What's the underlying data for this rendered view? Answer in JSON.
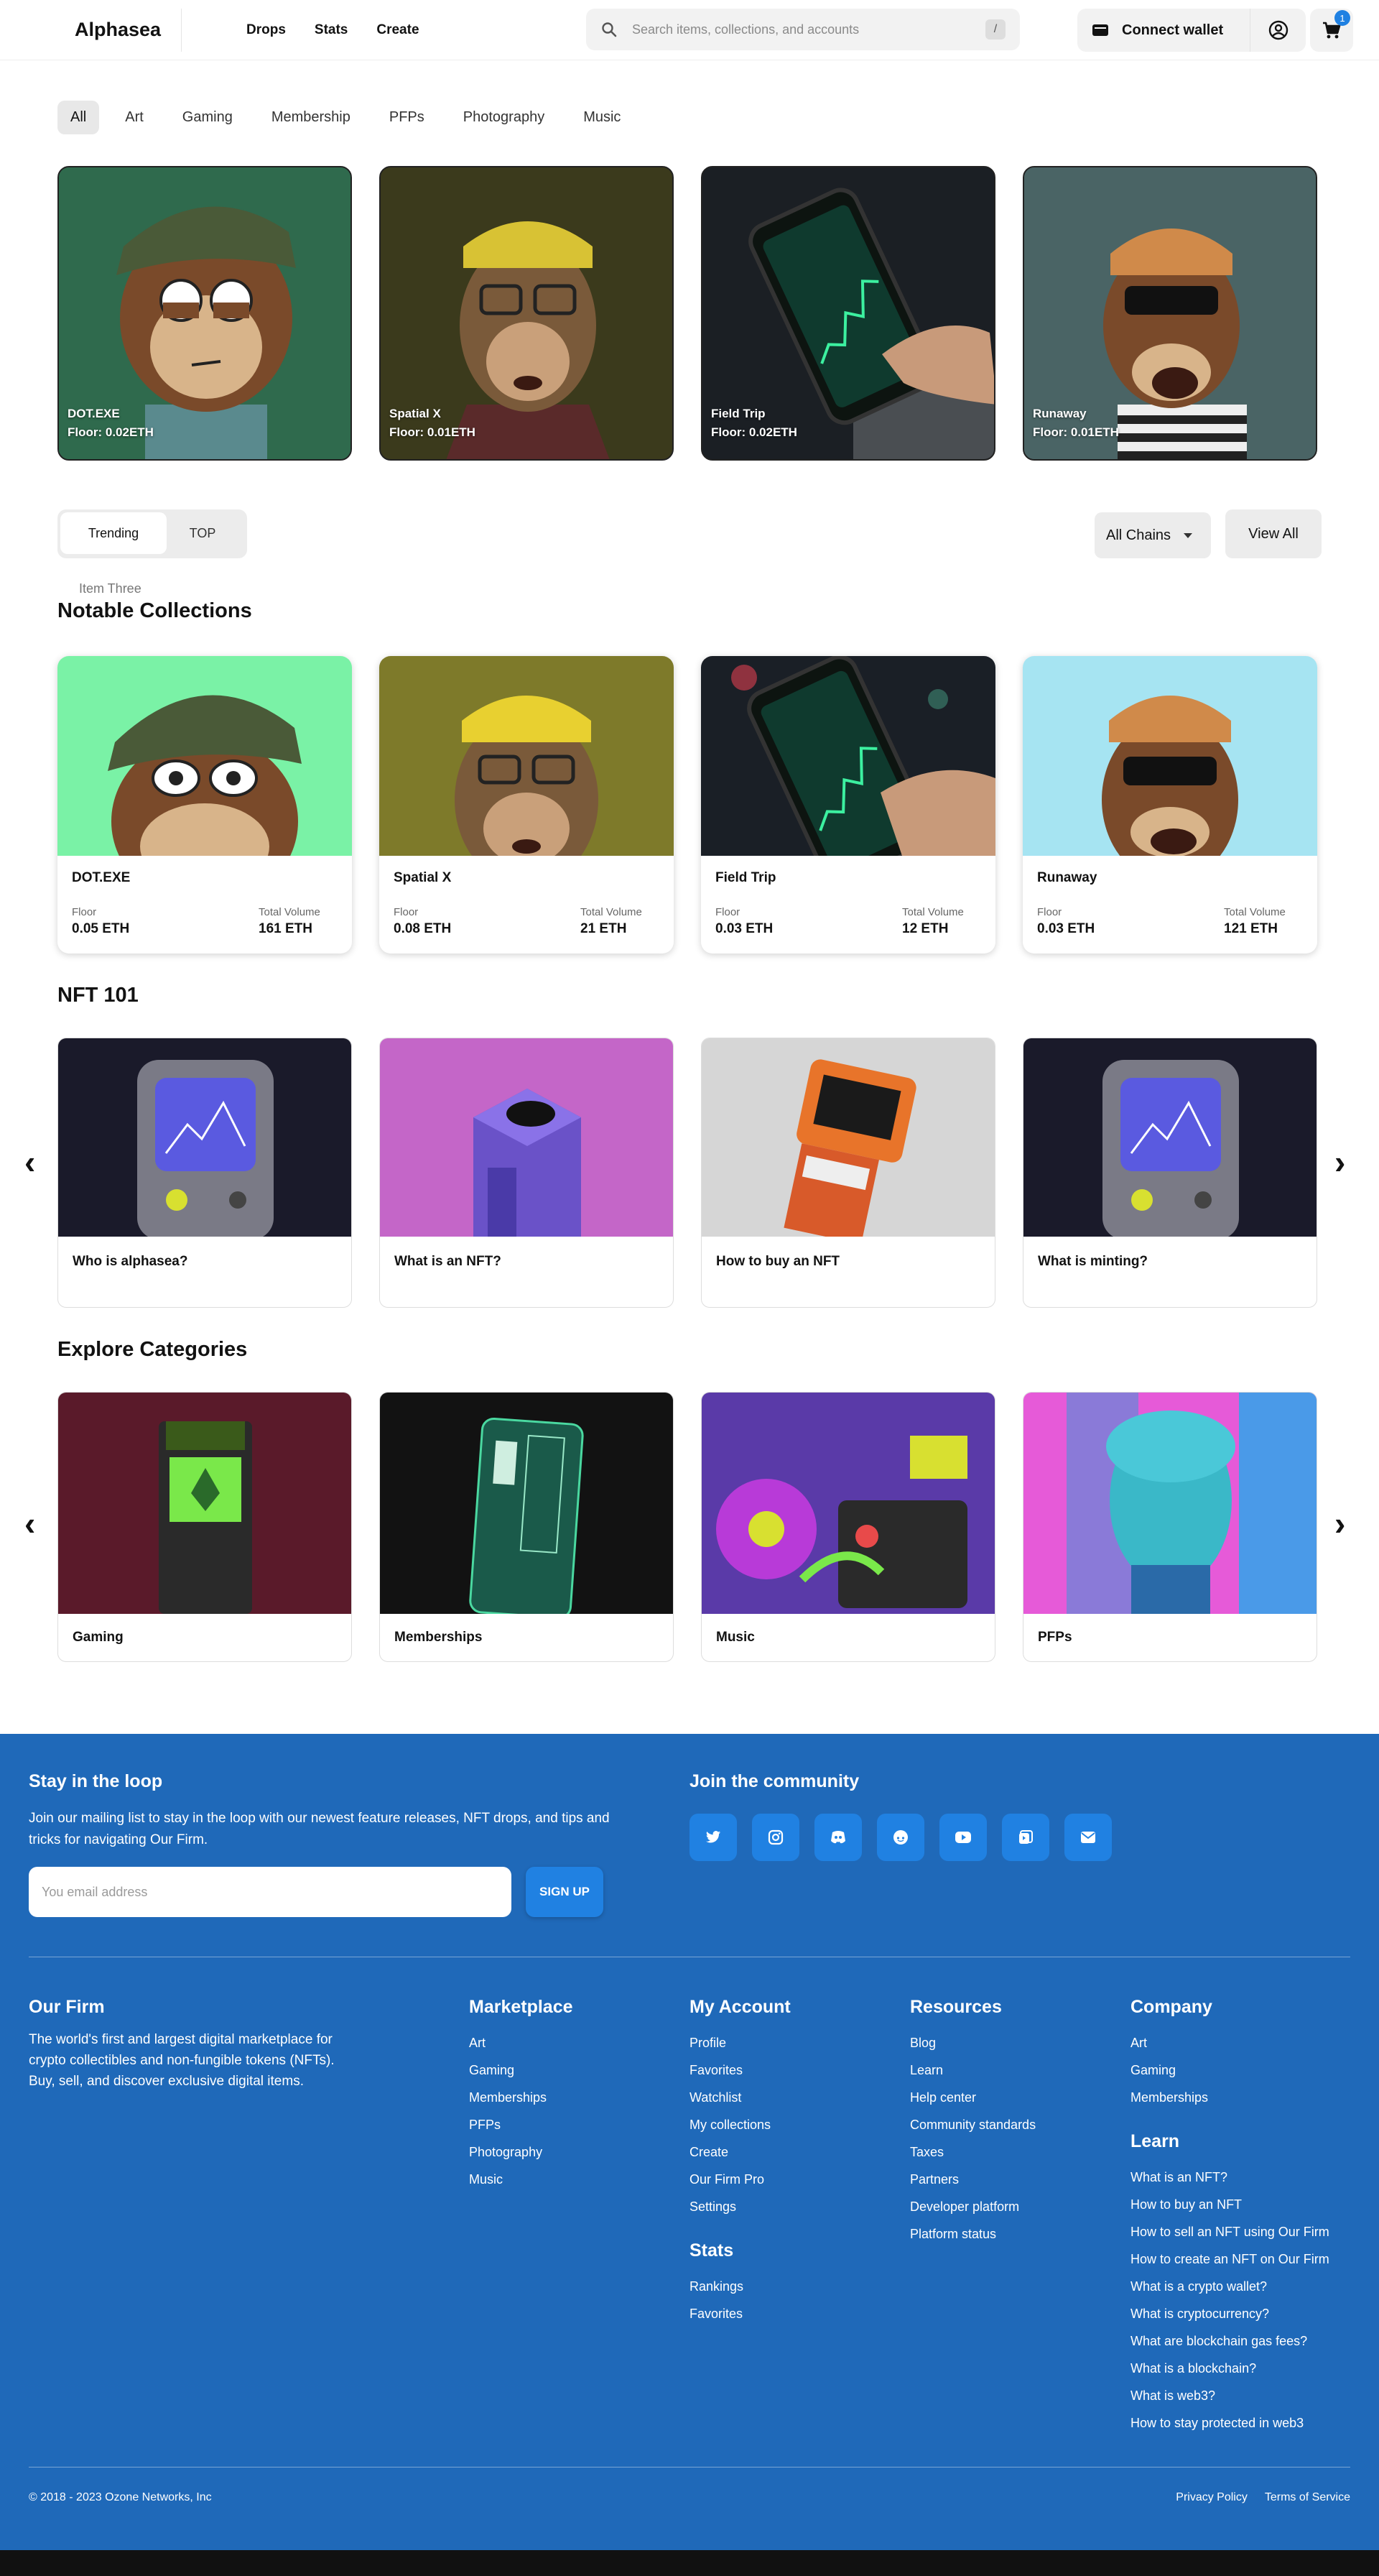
{
  "header": {
    "logo": "Alphasea",
    "nav": [
      "Drops",
      "Stats",
      "Create"
    ],
    "search_placeholder": "Search items, collections, and accounts",
    "search_shortcut": "/",
    "connect_label": "Connect wallet",
    "cart_count": "1"
  },
  "categories": [
    "All",
    "Art",
    "Gaming",
    "Membership",
    "PFPs",
    "Photography",
    "Music"
  ],
  "active_category": "All",
  "hero": [
    {
      "name": "DOT.EXE",
      "floor": "Floor: 0.02ETH",
      "bg": "#2f6a4d"
    },
    {
      "name": "Spatial X",
      "floor": "Floor: 0.01ETH",
      "bg": "#3b3a1c"
    },
    {
      "name": "Field Trip",
      "floor": "Floor: 0.02ETH",
      "bg": "#1b1f24"
    },
    {
      "name": "Runaway",
      "floor": "Floor: 0.01ETH",
      "bg": "#4a6465"
    }
  ],
  "trending": {
    "tabs": [
      "Trending",
      "TOP"
    ],
    "chains_label": "All Chains",
    "view_all": "View All"
  },
  "item_three": "Item Three",
  "notable": {
    "title": "Notable Collections",
    "floor_label": "Floor",
    "volume_label": "Total Volume",
    "items": [
      {
        "name": "DOT.EXE",
        "floor": "0.05 ETH",
        "volume": "161 ETH",
        "bg": "#7af2a6"
      },
      {
        "name": "Spatial X",
        "floor": "0.08 ETH",
        "volume": "21 ETH",
        "bg": "#7e7a2a"
      },
      {
        "name": "Field Trip",
        "floor": "0.03 ETH",
        "volume": "12 ETH",
        "bg": "#1a1f26"
      },
      {
        "name": "Runaway",
        "floor": "0.03 ETH",
        "volume": "121 ETH",
        "bg": "#a6e4f2"
      }
    ]
  },
  "nft101": {
    "title": "NFT 101",
    "items": [
      "Who is alphasea?",
      "What is an NFT?",
      "How to buy an NFT",
      "What is minting?"
    ]
  },
  "explore": {
    "title": "Explore Categories",
    "items": [
      "Gaming",
      "Memberships",
      "Music",
      "PFPs"
    ]
  },
  "footer": {
    "loop_title": "Stay in the loop",
    "loop_text": "Join our mailing list to stay in the loop with our newest feature releases, NFT drops, and tips and tricks for navigating Our Firm.",
    "email_placeholder": "You email address",
    "signup": "SIGN UP",
    "community_title": "Join the community",
    "social": [
      "twitter-icon",
      "instagram-icon",
      "discord-icon",
      "reddit-icon",
      "youtube-icon",
      "tiktok-icon",
      "email-icon"
    ],
    "firm_title": "Our Firm",
    "firm_text": "The world's first and largest digital marketplace for crypto collectibles and non-fungible tokens (NFTs). Buy, sell, and discover exclusive digital items.",
    "marketplace": {
      "title": "Marketplace",
      "links": [
        "Art",
        "Gaming",
        "Memberships",
        "PFPs",
        "Photography",
        "Music"
      ]
    },
    "account": {
      "title": "My Account",
      "links": [
        "Profile",
        "Favorites",
        "Watchlist",
        "My collections",
        "Create",
        "Our Firm Pro",
        "Settings"
      ]
    },
    "stats": {
      "title": "Stats",
      "links": [
        "Rankings",
        "Favorites"
      ]
    },
    "resources": {
      "title": "Resources",
      "links": [
        "Blog",
        "Learn",
        "Help center",
        "Community standards",
        "Taxes",
        "Partners",
        "Developer platform",
        "Platform status"
      ]
    },
    "company": {
      "title": "Company",
      "links": [
        "Art",
        "Gaming",
        "Memberships"
      ]
    },
    "learn": {
      "title": "Learn",
      "links": [
        "What is an NFT?",
        "How to buy an NFT",
        "How to sell an NFT using Our Firm",
        "How to create an NFT on Our Firm",
        "What is a crypto wallet?",
        "What is cryptocurrency?",
        "What are blockchain gas fees?",
        "What is a blockchain?",
        "What is web3?",
        "How to stay protected in web3"
      ]
    },
    "copyright": "© 2018 - 2023 Ozone Networks, Inc",
    "privacy": "Privacy Policy",
    "terms": "Terms of Service"
  },
  "colors": {
    "brand": "#2081e2",
    "footer_bg": "#1f69b9"
  }
}
